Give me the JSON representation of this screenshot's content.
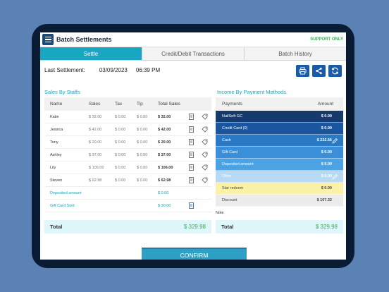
{
  "header": {
    "title": "Batch Settlements",
    "support": "SUPPORT ONLY"
  },
  "tabs": [
    "Settle",
    "Credit/Debit Transactions",
    "Batch History"
  ],
  "last_settlement": {
    "label": "Last Settlement:",
    "date": "03/09/2023",
    "time": "06:39 PM"
  },
  "sales_by_staffs": {
    "title": "Sales By Staffs",
    "columns": [
      "Name",
      "Sales",
      "Tax",
      "Tip",
      "Total Sales"
    ],
    "rows": [
      {
        "name": "Katie",
        "sales": "$ 32.00",
        "tax": "$ 0.00",
        "tip": "$ 0.00",
        "total": "$ 32.00"
      },
      {
        "name": "Jessica",
        "sales": "$ 42.00",
        "tax": "$ 0.00",
        "tip": "$ 0.00",
        "total": "$ 42.00"
      },
      {
        "name": "Tony",
        "sales": "$ 20.00",
        "tax": "$ 0.00",
        "tip": "$ 0.00",
        "total": "$ 20.00"
      },
      {
        "name": "Ashley",
        "sales": "$ 37.00",
        "tax": "$ 0.00",
        "tip": "$ 0.00",
        "total": "$ 37.00"
      },
      {
        "name": "Lily",
        "sales": "$ 106.00",
        "tax": "$ 0.00",
        "tip": "$ 0.00",
        "total": "$ 106.00"
      },
      {
        "name": "Steven",
        "sales": "$ 62.98",
        "tax": "$ 0.00",
        "tip": "$ 0.00",
        "total": "$ 62.98"
      }
    ],
    "deposited": {
      "label": "Deposited amount",
      "value": "$ 0.00"
    },
    "gift_card": {
      "label": "Gift Card Sold",
      "value": "$ 30.00"
    },
    "total_label": "Total",
    "total_value": "$ 329.98"
  },
  "income": {
    "title": "Income By Payment Methods",
    "columns": [
      "Payments",
      "Amount"
    ],
    "rows": [
      {
        "label": "NailSoft GC",
        "amount": "$ 0.00",
        "bg": "#153b6e",
        "fg": "#ffffff",
        "editable": false
      },
      {
        "label": "Credit Card (0)",
        "amount": "$ 0.00",
        "bg": "#1a56a0",
        "fg": "#ffffff",
        "editable": false
      },
      {
        "label": "Cash",
        "amount": "$ 222.66",
        "bg": "#2a79c4",
        "fg": "#ffffff",
        "editable": true
      },
      {
        "label": "Gift Card",
        "amount": "$ 0.00",
        "bg": "#3a8fd8",
        "fg": "#ffffff",
        "editable": false
      },
      {
        "label": "Deposited amount",
        "amount": "$ 0.00",
        "bg": "#4da2e4",
        "fg": "#ffffff",
        "editable": false
      },
      {
        "label": "Other",
        "amount": "$ 0.00",
        "bg": "#b8d9f4",
        "fg": "#ffffff",
        "editable": true
      },
      {
        "label": "Star redeem",
        "amount": "$ 0.00",
        "bg": "#fbf2a8",
        "fg": "#444444",
        "editable": false
      },
      {
        "label": "Discount",
        "amount": "$ 107.32",
        "bg": "#ececec",
        "fg": "#444444",
        "editable": false
      }
    ],
    "note_label": "Note",
    "total_label": "Total",
    "total_value": "$ 329.98"
  },
  "confirm_label": "CONFIRM",
  "icons": [
    "menu-icon",
    "printer-icon",
    "share-icon",
    "refresh-icon",
    "receipt-icon",
    "tag-icon",
    "edit-icon"
  ]
}
